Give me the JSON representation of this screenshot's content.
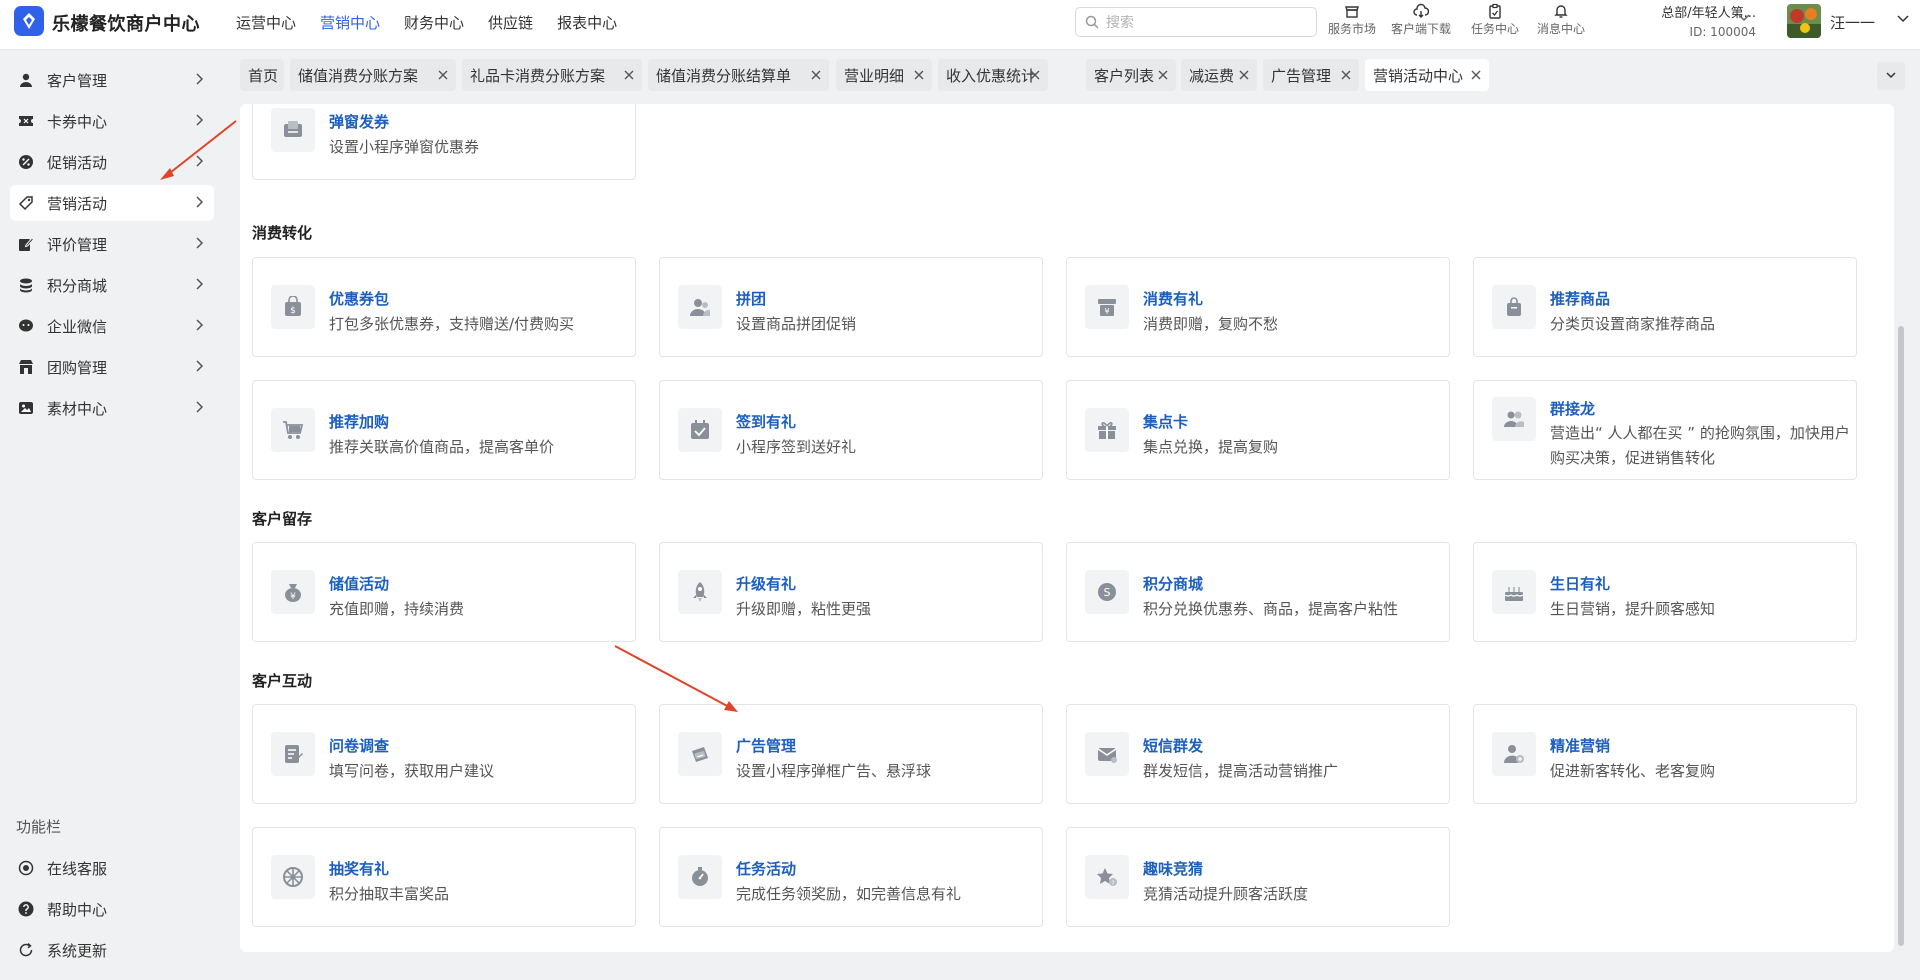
{
  "app": {
    "title": "乐檬餐饮商户中心"
  },
  "top_nav": [
    "运营中心",
    "营销中心",
    "财务中心",
    "供应链",
    "报表中心"
  ],
  "search": {
    "placeholder": "搜索"
  },
  "toolbar": [
    {
      "label": "服务市场",
      "icon": "store-icon"
    },
    {
      "label": "客户端下载",
      "icon": "cloud-download-icon"
    },
    {
      "label": "任务中心",
      "icon": "clipboard-icon"
    },
    {
      "label": "消息中心",
      "icon": "bell-icon"
    }
  ],
  "org": {
    "name": "总部/年轻人第...",
    "id": "ID: 100004"
  },
  "user": {
    "name": "汪一一"
  },
  "sidebar": {
    "items": [
      {
        "label": "客户管理",
        "icon": "user-icon"
      },
      {
        "label": "卡券中心",
        "icon": "ticket-icon"
      },
      {
        "label": "促销活动",
        "icon": "discount-badge-icon"
      },
      {
        "label": "营销活动",
        "icon": "tag-icon"
      },
      {
        "label": "评价管理",
        "icon": "edit-icon"
      },
      {
        "label": "积分商城",
        "icon": "coins-icon"
      },
      {
        "label": "企业微信",
        "icon": "chat-icon"
      },
      {
        "label": "团购管理",
        "icon": "shop-icon"
      },
      {
        "label": "素材中心",
        "icon": "image-icon"
      }
    ],
    "section_label": "功能栏",
    "footer_items": [
      {
        "label": "在线客服",
        "icon": "headset-icon"
      },
      {
        "label": "帮助中心",
        "icon": "help-icon"
      },
      {
        "label": "系统更新",
        "icon": "refresh-icon"
      }
    ]
  },
  "tabs": [
    {
      "label": "首页",
      "closable": false
    },
    {
      "label": "储值消费分账方案",
      "closable": true
    },
    {
      "label": "礼品卡消费分账方案",
      "closable": true
    },
    {
      "label": "储值消费分账结算单",
      "closable": true
    },
    {
      "label": "营业明细",
      "closable": true
    },
    {
      "label": "收入优惠统计",
      "closable": true
    },
    {
      "label": "客户列表",
      "closable": true
    },
    {
      "label": "减运费",
      "closable": true
    },
    {
      "label": "广告管理",
      "closable": true
    },
    {
      "label": "营销活动中心",
      "closable": true
    }
  ],
  "sections": [
    {
      "title": "",
      "cards": [
        {
          "title": "弹窗发券",
          "desc": "设置小程序弹窗优惠券",
          "icon": "popup-coupon-icon"
        }
      ]
    },
    {
      "title": "消费转化",
      "cards": [
        {
          "title": "优惠券包",
          "desc": "打包多张优惠券，支持赠送/付费购买",
          "icon": "coupon-bag-icon"
        },
        {
          "title": "拼团",
          "desc": "设置商品拼团促销",
          "icon": "group-buy-icon"
        },
        {
          "title": "消费有礼",
          "desc": "消费即赠，复购不愁",
          "icon": "gift-box-icon"
        },
        {
          "title": "推荐商品",
          "desc": "分类页设置商家推荐商品",
          "icon": "shopping-bag-icon"
        },
        {
          "title": "推荐加购",
          "desc": "推荐关联高价值商品，提高客单价",
          "icon": "cart-icon"
        },
        {
          "title": "签到有礼",
          "desc": "小程序签到送好礼",
          "icon": "calendar-check-icon"
        },
        {
          "title": "集点卡",
          "desc": "集点兑换，提高复购",
          "icon": "gift-icon"
        },
        {
          "title": "群接龙",
          "desc": "营造出“ 人人都在买 ” 的抢购氛围，加快用户购买决策，促进销售转化",
          "icon": "people-icon"
        }
      ]
    },
    {
      "title": "客户留存",
      "cards": [
        {
          "title": "储值活动",
          "desc": "充值即赠，持续消费",
          "icon": "money-bag-icon"
        },
        {
          "title": "升级有礼",
          "desc": "升级即赠，粘性更强",
          "icon": "rocket-icon"
        },
        {
          "title": "积分商城",
          "desc": "积分兑换优惠券、商品，提高客户粘性",
          "icon": "points-coin-icon"
        },
        {
          "title": "生日有礼",
          "desc": "生日营销，提升顾客感知",
          "icon": "cake-icon"
        }
      ]
    },
    {
      "title": "客户互动",
      "cards": [
        {
          "title": "问卷调查",
          "desc": "填写问卷，获取用户建议",
          "icon": "survey-icon"
        },
        {
          "title": "广告管理",
          "desc": "设置小程序弹框广告、悬浮球",
          "icon": "ad-icon"
        },
        {
          "title": "短信群发",
          "desc": "群发短信，提高活动营销推广",
          "icon": "sms-icon"
        },
        {
          "title": "精准营销",
          "desc": "促进新客转化、老客复购",
          "icon": "user-target-icon"
        },
        {
          "title": "抽奖有礼",
          "desc": "积分抽取丰富奖品",
          "icon": "lottery-wheel-icon"
        },
        {
          "title": "任务活动",
          "desc": "完成任务领奖励，如完善信息有礼",
          "icon": "task-timer-icon"
        },
        {
          "title": "趣味竞猜",
          "desc": "竞猜活动提升顾客活跃度",
          "icon": "guess-star-icon"
        }
      ]
    }
  ],
  "colors": {
    "brand": "#2f62e9",
    "card_title": "#1d5fbf",
    "annotation_arrow": "#e0452b"
  }
}
